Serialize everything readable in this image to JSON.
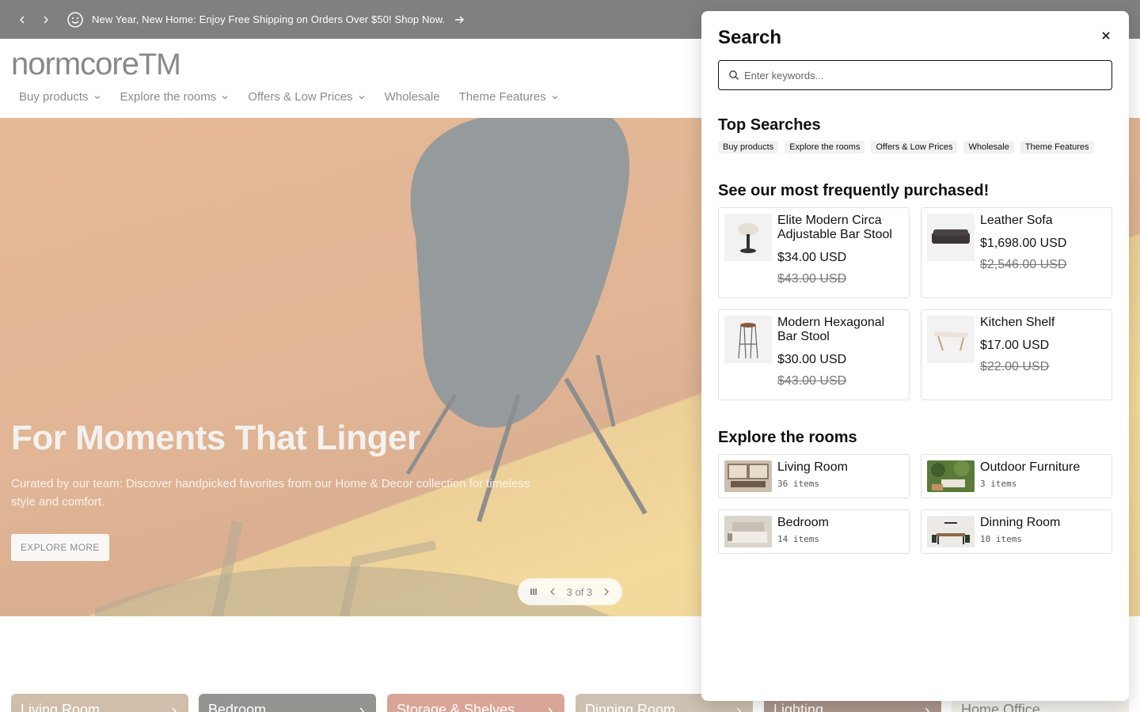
{
  "announcement": {
    "message": "New Year, New Home: Enjoy Free Shipping on Orders Over $50! Shop Now."
  },
  "header": {
    "logo": "normcore",
    "logo_mark": "TM",
    "nav": [
      {
        "label": "Buy products",
        "has_dropdown": true
      },
      {
        "label": "Explore the rooms",
        "has_dropdown": true
      },
      {
        "label": "Offers & Low Prices",
        "has_dropdown": true
      },
      {
        "label": "Wholesale",
        "has_dropdown": false
      },
      {
        "label": "Theme Features",
        "has_dropdown": true
      }
    ]
  },
  "hero": {
    "title": "For Moments That Linger",
    "subtitle": "Curated by our team: Discover handpicked favorites from our Home & Decor collection for timeless style and comfort.",
    "button": "EXPLORE MORE",
    "slide_indicator": "3 of 3"
  },
  "collections": [
    {
      "label": "Living Room",
      "color": "#a07d57"
    },
    {
      "label": "Bedroom",
      "color": "#262a20"
    },
    {
      "label": "Storage & Shelves",
      "color": "#b24a2f"
    },
    {
      "label": "Dinning Room",
      "color": "#9b8262"
    },
    {
      "label": "Lighting",
      "color": "#5a2e1b"
    },
    {
      "label": "Home Office",
      "color": "#e6e0d8"
    }
  ],
  "search": {
    "title": "Search",
    "placeholder": "Enter keywords...",
    "top_searches_title": "Top Searches",
    "top_searches": [
      "Buy products",
      "Explore the rooms",
      "Offers & Low Prices",
      "Wholesale",
      "Theme Features"
    ],
    "frequent_title": "See our most frequently purchased!",
    "products": [
      {
        "name": "Elite Modern Circa Adjustable Bar Stool",
        "price": "$34.00 USD",
        "compare": "$43.00 USD"
      },
      {
        "name": "Leather Sofa",
        "price": "$1,698.00 USD",
        "compare": "$2,546.00 USD"
      },
      {
        "name": "Modern Hexagonal Bar Stool",
        "price": "$30.00 USD",
        "compare": "$43.00 USD"
      },
      {
        "name": "Kitchen Shelf",
        "price": "$17.00 USD",
        "compare": "$22.00 USD"
      }
    ],
    "rooms_title": "Explore the rooms",
    "rooms": [
      {
        "name": "Living Room",
        "count": "36 items"
      },
      {
        "name": "Outdoor Furniture",
        "count": "3 items"
      },
      {
        "name": "Bedroom",
        "count": "14 items"
      },
      {
        "name": "Dinning Room",
        "count": "10 items"
      }
    ]
  }
}
